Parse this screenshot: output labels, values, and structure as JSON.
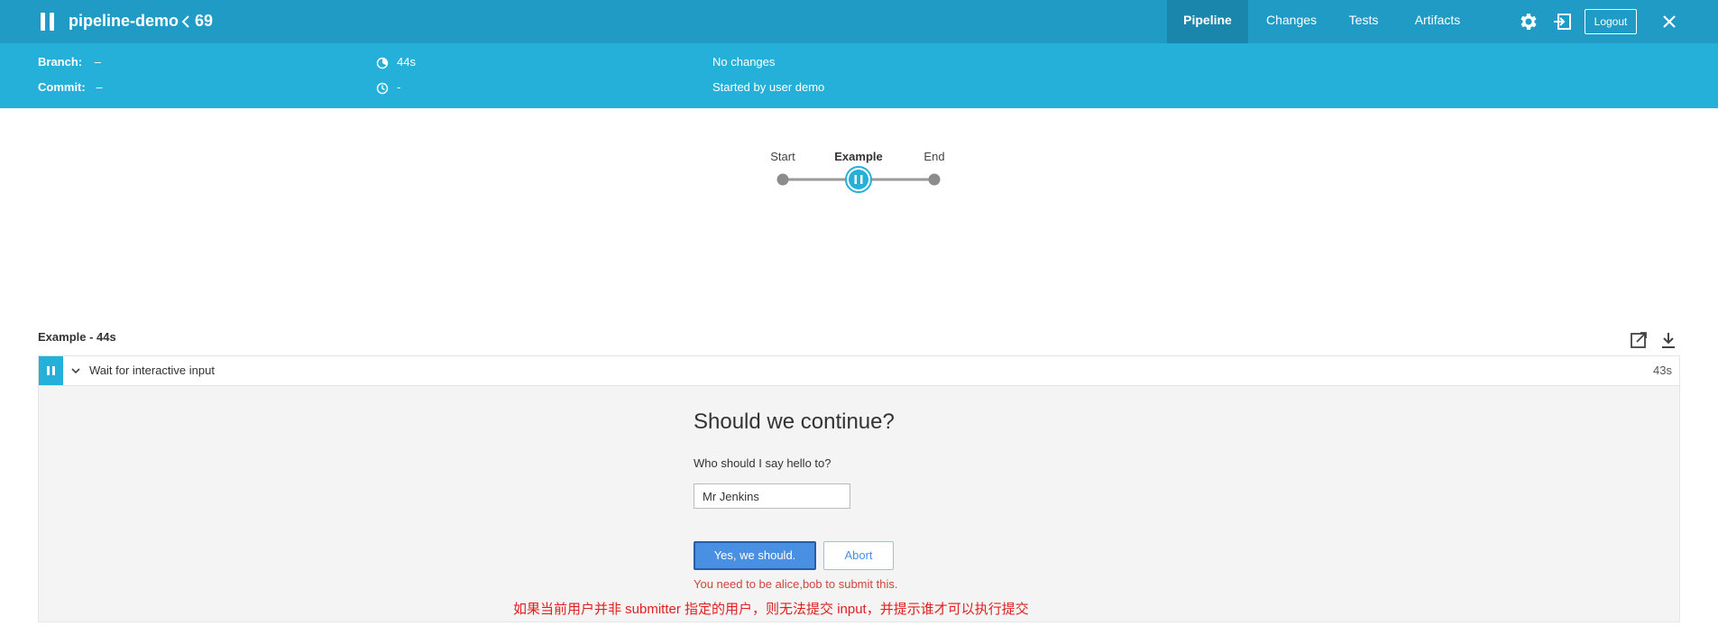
{
  "header": {
    "pipeline_name": "pipeline-demo",
    "run_number": "69",
    "tabs": [
      {
        "label": "Pipeline",
        "active": true
      },
      {
        "label": "Changes",
        "active": false
      },
      {
        "label": "Tests",
        "active": false
      },
      {
        "label": "Artifacts",
        "active": false
      }
    ],
    "logout_label": "Logout",
    "icons": [
      "pause-icon",
      "chevron-left-icon",
      "gear-icon",
      "exit-icon",
      "close-icon"
    ]
  },
  "run_info": {
    "branch_label": "Branch:",
    "branch_value": "–",
    "commit_label": "Commit:",
    "commit_value": "–",
    "duration": "44s",
    "started_ago": "-",
    "changes": "No changes",
    "cause": "Started by user demo"
  },
  "graph": {
    "stages": [
      "Start",
      "Example",
      "End"
    ],
    "active_stage": "Example"
  },
  "log": {
    "stage_title": "Example - 44s",
    "step": {
      "label": "Wait for interactive input",
      "duration": "43s"
    }
  },
  "input_form": {
    "title": "Should we continue?",
    "question": "Who should I say hello to?",
    "input_value": "Mr Jenkins",
    "submit_label": "Yes, we should.",
    "abort_label": "Abort",
    "error": "You need to be alice,bob to submit this."
  },
  "annotation": "如果当前用户并非 submitter 指定的用户，则无法提交 input，并提示谁才可以执行提交",
  "colors": {
    "topbar": "#1f9bc6",
    "infobar": "#24b0d9",
    "active_tab": "#1a86ac",
    "primary_button": "#4a90e2",
    "error": "#d0453b",
    "annotation": "#e02020"
  }
}
